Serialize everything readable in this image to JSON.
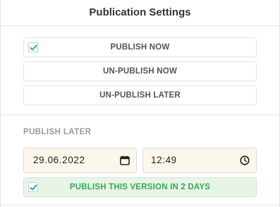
{
  "panel": {
    "title": "Publication Settings"
  },
  "actions": {
    "publish_now": {
      "label": "PUBLISH NOW",
      "checked": true
    },
    "unpublish_now": {
      "label": "UN-PUBLISH NOW"
    },
    "unpublish_later": {
      "label": "UN-PUBLISH LATER"
    }
  },
  "publish_later": {
    "label": "PUBLISH LATER",
    "date_value": "29.06.2022",
    "time_value": "12:49",
    "confirm_label": "PUBLISH THIS VERSION IN 2 DAYS",
    "confirm_checked": true
  },
  "icons": {
    "checkmark": "check-icon",
    "calendar": "calendar-icon",
    "clock": "clock-icon"
  },
  "colors": {
    "accent": "#2fb0a6",
    "confirm_text": "#3aa555",
    "confirm_bg": "#e6f5e8",
    "input_bg": "#fdf6ec"
  }
}
